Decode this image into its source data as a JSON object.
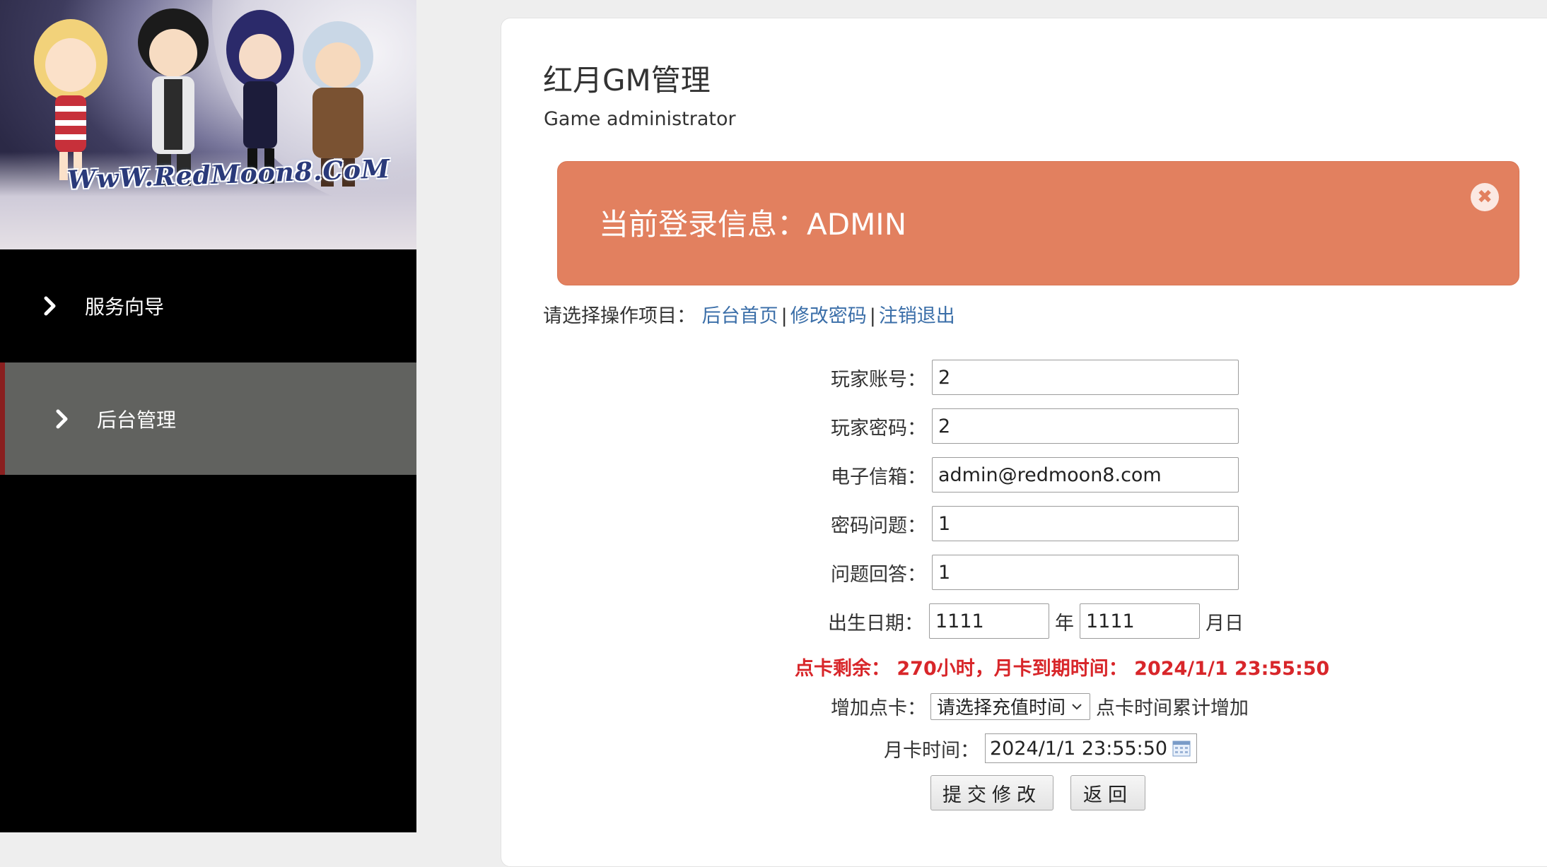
{
  "sidebar": {
    "logo_text": "WwW.RedMoon8.CoM",
    "items": [
      {
        "label": "服务向导"
      },
      {
        "label": "后台管理"
      }
    ]
  },
  "header": {
    "title": "红月GM管理",
    "subtitle": "Game administrator"
  },
  "alert": {
    "message": "当前登录信息：ADMIN",
    "close_glyph": "✖"
  },
  "ops": {
    "prefix": "请选择操作项目：",
    "links": [
      "后台首页",
      "修改密码",
      "注销退出"
    ],
    "separator": "|"
  },
  "form": {
    "account": {
      "label": "玩家账号：",
      "value": "2"
    },
    "password": {
      "label": "玩家密码：",
      "value": "2"
    },
    "email": {
      "label": "电子信箱：",
      "value": "admin@redmoon8.com"
    },
    "question": {
      "label": "密码问题：",
      "value": "1"
    },
    "answer": {
      "label": "问题回答：",
      "value": "1"
    },
    "birth": {
      "label": "出生日期：",
      "year": "1111",
      "year_unit": "年",
      "monthday": "1111",
      "monthday_unit": "月日"
    },
    "status": "点卡剩余： 270小时，月卡到期时间： 2024/1/1 23:55:50",
    "addcard": {
      "label": "增加点卡：",
      "selected": "请选择充值时间",
      "note": "点卡时间累计增加"
    },
    "monthcard": {
      "label": "月卡时间：",
      "value": "2024/1/1 23:55:50"
    },
    "submit_label": "提交修改",
    "back_label": "返回"
  },
  "colors": {
    "alert_bg": "#e2805f",
    "link": "#3a6ea8",
    "warn": "#d8262a",
    "sidebar_active": "#61625f",
    "sidebar_active_border": "#8a1f1f"
  }
}
